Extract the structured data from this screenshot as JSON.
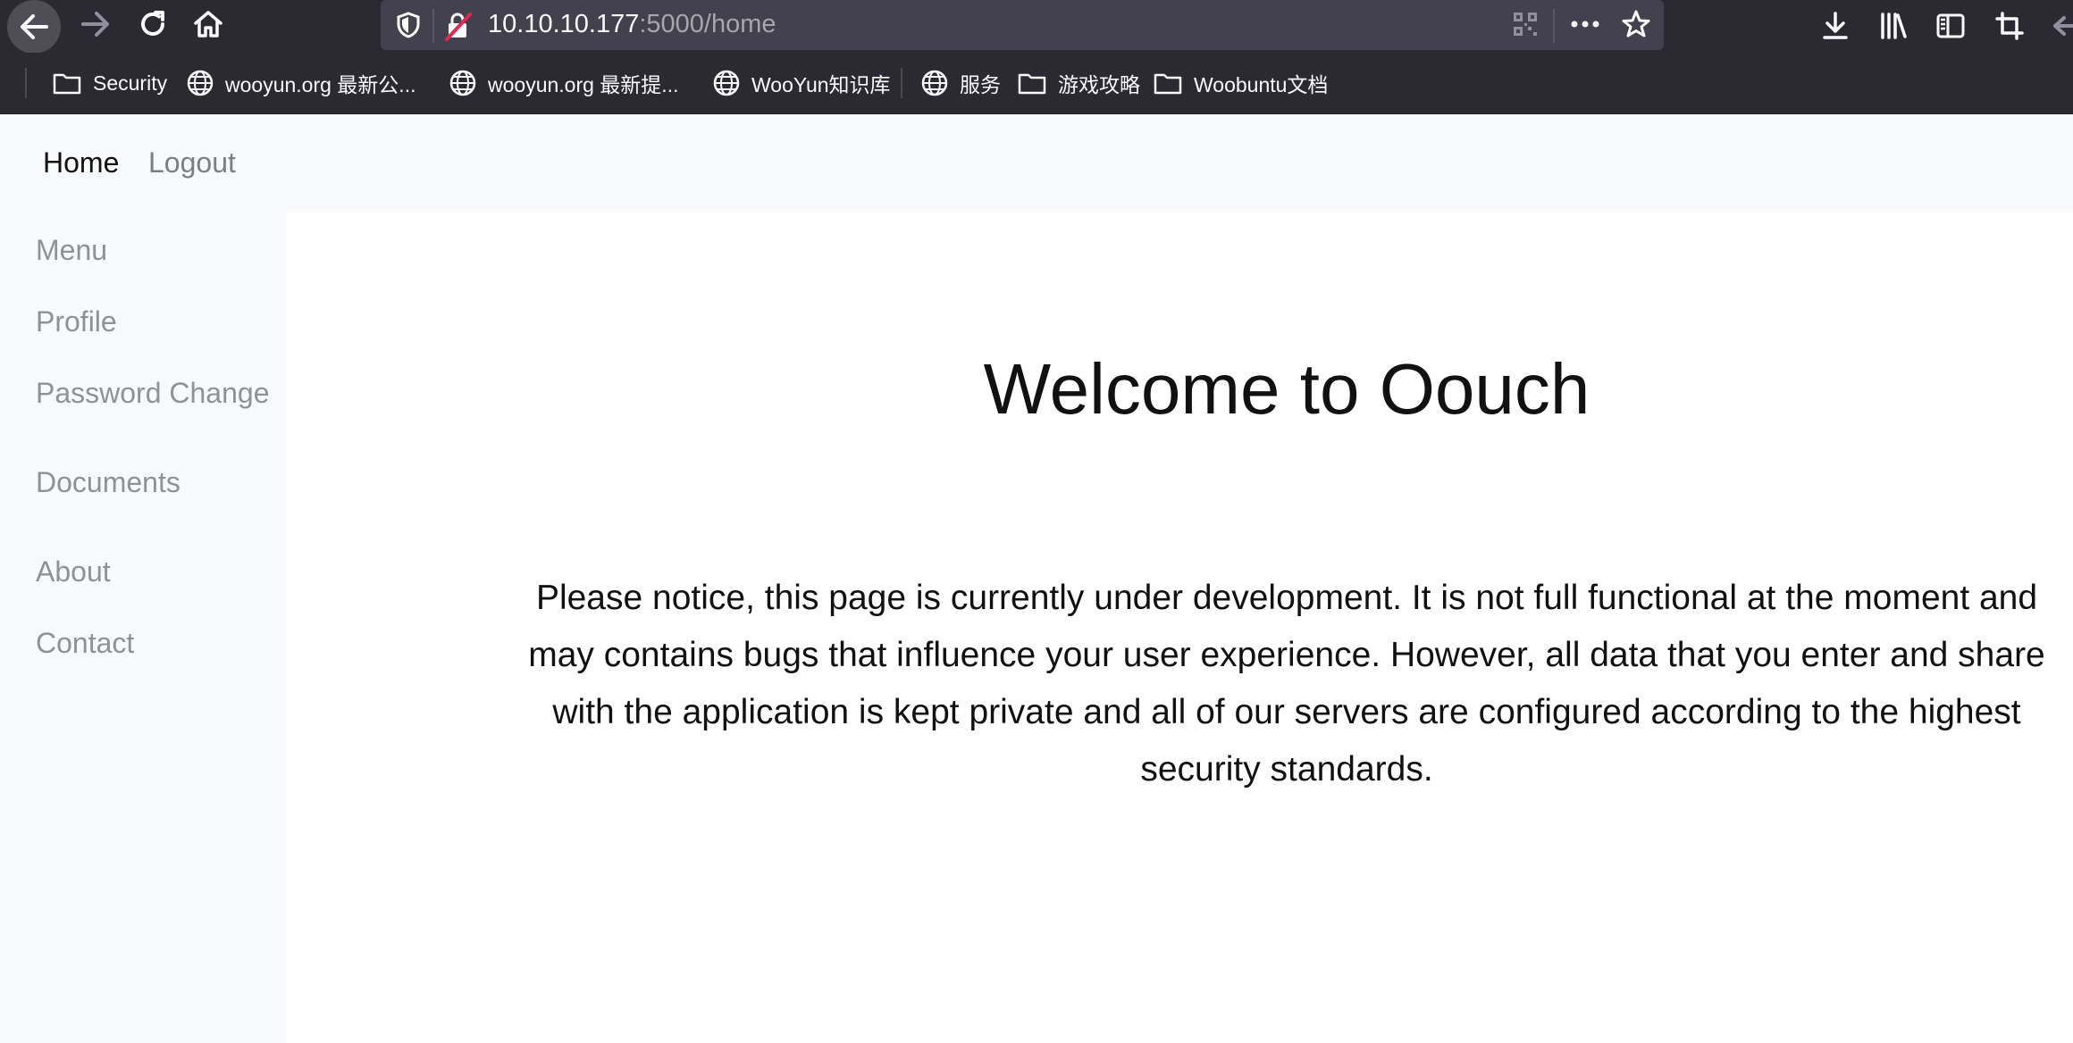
{
  "browser": {
    "url_host": "10.10.10.177",
    "url_path": ":5000/home",
    "bookmarks": [
      {
        "label": "Security",
        "icon": "folder-icon"
      },
      {
        "label": "wooyun.org 最新公...",
        "icon": "globe-icon"
      },
      {
        "label": "wooyun.org 最新提...",
        "icon": "globe-icon"
      },
      {
        "label": "WooYun知识库",
        "icon": "globe-icon"
      },
      {
        "label": "服务",
        "icon": "globe-icon"
      },
      {
        "label": "游戏攻略",
        "icon": "folder-icon"
      },
      {
        "label": "Woobuntu文档",
        "icon": "folder-icon"
      }
    ]
  },
  "nav": {
    "home": "Home",
    "logout": "Logout"
  },
  "sidebar": {
    "items": [
      "Menu",
      "Profile",
      "Password Change",
      "Documents",
      "About",
      "Contact"
    ]
  },
  "main": {
    "title": "Welcome to Oouch",
    "notice": "Please notice, this page is currently under development. It is not full functional at the moment and may contains bugs that influence your user experience. However, all data that you enter and share with the application is kept private and all of our servers are configured according to the highest security standards."
  }
}
